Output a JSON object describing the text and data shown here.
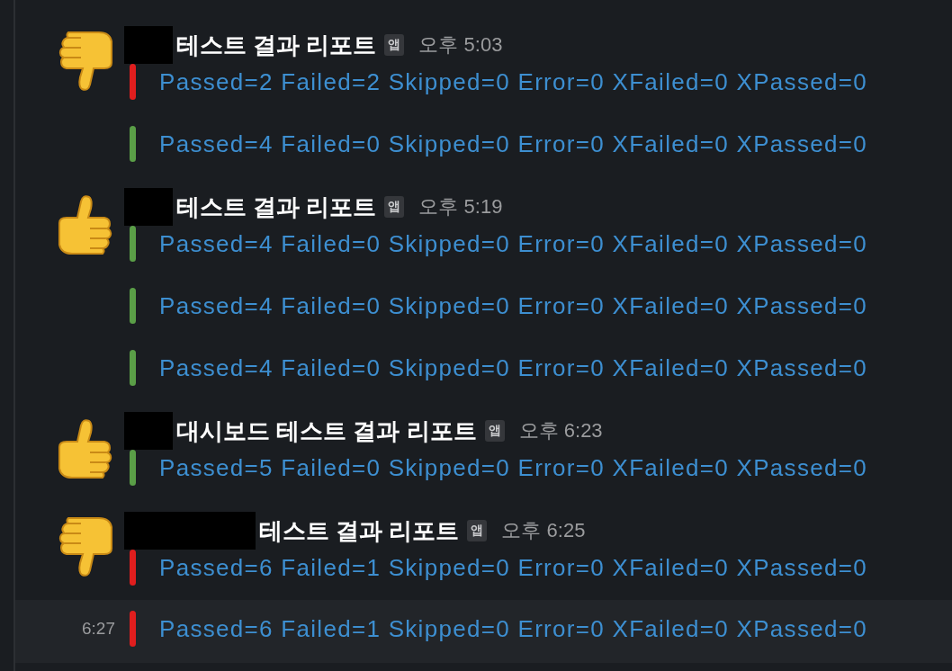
{
  "messages": [
    {
      "kind": "full",
      "avatar": {
        "kind": "thumbs_down"
      },
      "redaction": {
        "kind": "short"
      },
      "app_name": "테스트 결과 리포트",
      "badge": "앱",
      "time": "오후 5:03",
      "hovered": false,
      "attachments": [
        {
          "color": "#e01e1e",
          "text": "Passed=2 Failed=2 Skipped=0 Error=0 XFailed=0 XPassed=0"
        },
        {
          "color": "#5a9e47",
          "text": "Passed=4 Failed=0 Skipped=0 Error=0 XFailed=0 XPassed=0"
        }
      ]
    },
    {
      "kind": "full",
      "avatar": {
        "kind": "thumbs_up"
      },
      "redaction": {
        "kind": "short"
      },
      "app_name": "테스트 결과 리포트",
      "badge": "앱",
      "time": "오후 5:19",
      "hovered": false,
      "attachments": [
        {
          "color": "#5a9e47",
          "text": "Passed=4 Failed=0 Skipped=0 Error=0 XFailed=0 XPassed=0"
        },
        {
          "color": "#5a9e47",
          "text": "Passed=4 Failed=0 Skipped=0 Error=0 XFailed=0 XPassed=0"
        },
        {
          "color": "#5a9e47",
          "text": "Passed=4 Failed=0 Skipped=0 Error=0 XFailed=0 XPassed=0"
        }
      ]
    },
    {
      "kind": "full",
      "avatar": {
        "kind": "thumbs_up"
      },
      "redaction": {
        "kind": "short"
      },
      "app_name": "대시보드 테스트 결과 리포트",
      "badge": "앱",
      "time": "오후 6:23",
      "hovered": false,
      "attachments": [
        {
          "color": "#5a9e47",
          "text": "Passed=5 Failed=0 Skipped=0 Error=0 XFailed=0 XPassed=0"
        }
      ]
    },
    {
      "kind": "full",
      "avatar": {
        "kind": "thumbs_down"
      },
      "redaction": {
        "kind": "long"
      },
      "app_name": "테스트 결과 리포트",
      "badge": "앱",
      "time": "오후 6:25",
      "hovered": false,
      "attachments": [
        {
          "color": "#e01e1e",
          "text": "Passed=6 Failed=1 Skipped=0 Error=0 XFailed=0 XPassed=0"
        }
      ]
    },
    {
      "kind": "continuation",
      "time": "6:27",
      "hovered": true,
      "attachments": [
        {
          "color": "#e01e1e",
          "text": "Passed=6 Failed=1 Skipped=0 Error=0 XFailed=0 XPassed=0"
        }
      ]
    }
  ]
}
